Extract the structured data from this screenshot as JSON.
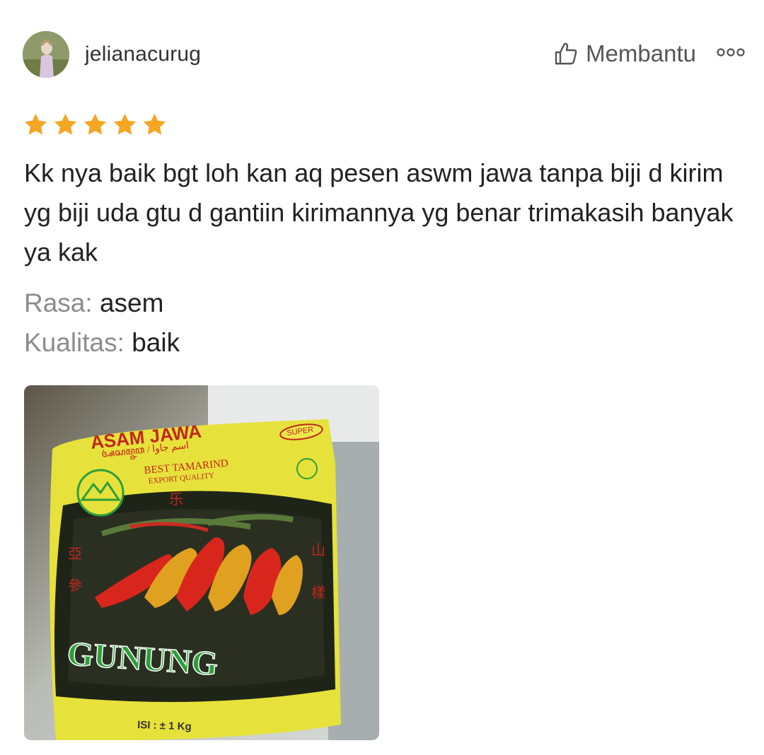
{
  "review": {
    "username": "jelianacurug",
    "helpful_label": "Membantu",
    "rating": 5,
    "text": "Kk nya baik bgt loh kan aq pesen aswm jawa tanpa biji d kirim yg biji uda gtu d gantiin kirimannya yg benar trimakasih banyak ya kak",
    "attributes": [
      {
        "key": "Rasa:",
        "value": "asem"
      },
      {
        "key": "Kualitas:",
        "value": "baik"
      }
    ],
    "photo": {
      "brand": "GUNUNG",
      "title": "ASAM JAWA",
      "badge": "SUPER",
      "tagline1": "BEST TAMARIND",
      "tagline2": "EXPORT QUALITY",
      "weight": "ISI : ± 1 Kg"
    }
  },
  "colors": {
    "star": "#F5A623",
    "username": "#333333",
    "text": "#222222",
    "attr_key": "#8C8C8C",
    "package_yellow": "#E7E23B",
    "package_green": "#2E9E3A",
    "package_red": "#D9261C"
  },
  "icons": {
    "thumb": "thumbs-up-outline-icon",
    "more": "more-dots-icon",
    "star": "star-filled-icon"
  }
}
